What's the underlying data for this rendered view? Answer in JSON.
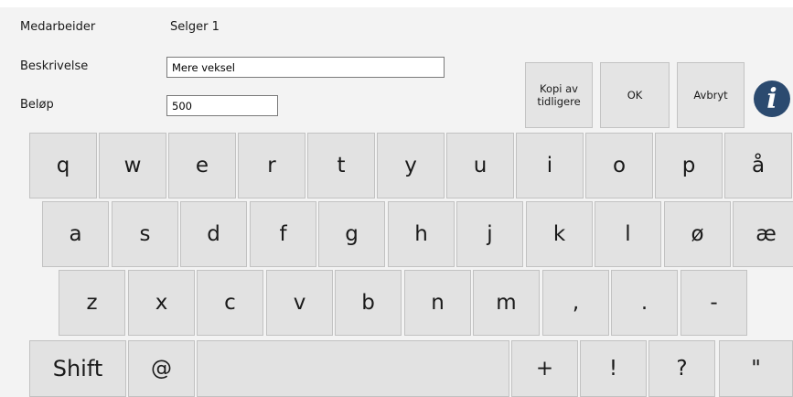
{
  "form": {
    "employee_label": "Medarbeider",
    "employee_value": "Selger 1",
    "description_label": "Beskrivelse",
    "description_value": "Mere veksel",
    "amount_label": "Beløp",
    "amount_value": "500"
  },
  "actions": {
    "copy_label": "Kopi av tidligere",
    "ok_label": "OK",
    "cancel_label": "Avbryt",
    "info_glyph": "i"
  },
  "keyboard": {
    "row1": [
      "q",
      "w",
      "e",
      "r",
      "t",
      "y",
      "u",
      "i",
      "o",
      "p",
      "å"
    ],
    "row2": [
      "a",
      "s",
      "d",
      "f",
      "g",
      "h",
      "j",
      "k",
      "l",
      "ø",
      "æ"
    ],
    "row3": [
      "z",
      "x",
      "c",
      "v",
      "b",
      "n",
      "m",
      ",",
      ".",
      "-"
    ],
    "row4": [
      "Shift",
      "@",
      "",
      "+",
      "!",
      "?",
      "\""
    ]
  },
  "colors": {
    "background": "#f3f3f3",
    "key": "#e2e2e2",
    "info_icon": "#2b4a6f"
  }
}
